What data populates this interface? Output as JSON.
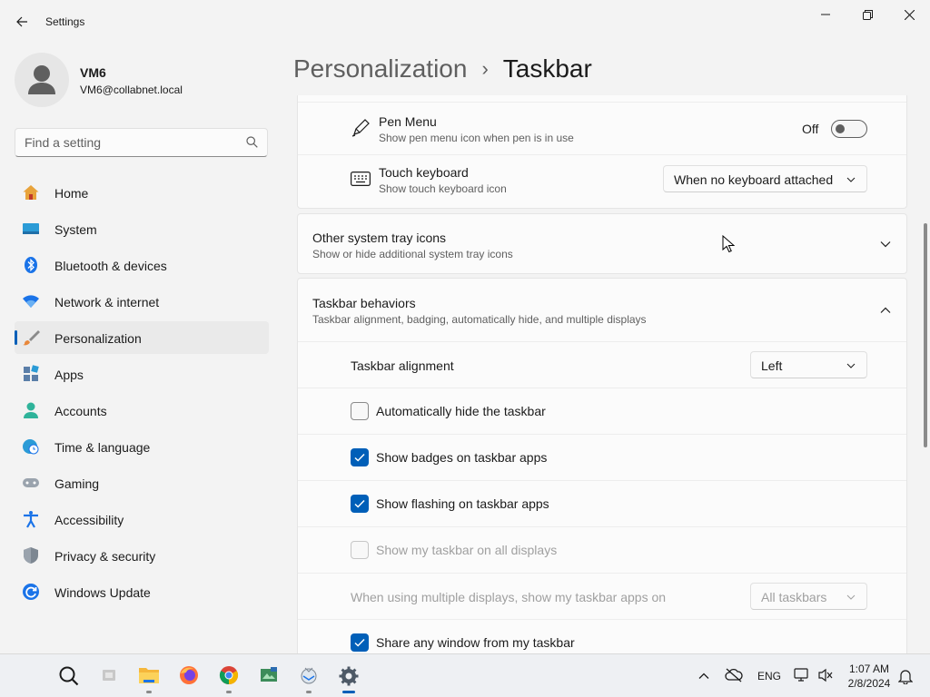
{
  "window": {
    "title": "Settings"
  },
  "profile": {
    "name": "VM6",
    "email": "VM6@collabnet.local"
  },
  "search": {
    "placeholder": "Find a setting"
  },
  "sidebar": {
    "items": [
      {
        "label": "Home",
        "icon": "home-icon"
      },
      {
        "label": "System",
        "icon": "system-icon"
      },
      {
        "label": "Bluetooth & devices",
        "icon": "bluetooth-icon"
      },
      {
        "label": "Network & internet",
        "icon": "wifi-icon"
      },
      {
        "label": "Personalization",
        "icon": "brush-icon",
        "active": true
      },
      {
        "label": "Apps",
        "icon": "apps-icon"
      },
      {
        "label": "Accounts",
        "icon": "person-icon"
      },
      {
        "label": "Time & language",
        "icon": "clock-globe-icon"
      },
      {
        "label": "Gaming",
        "icon": "gamepad-icon"
      },
      {
        "label": "Accessibility",
        "icon": "accessibility-icon"
      },
      {
        "label": "Privacy & security",
        "icon": "shield-icon"
      },
      {
        "label": "Windows Update",
        "icon": "update-icon"
      }
    ]
  },
  "breadcrumb": {
    "parent": "Personalization",
    "separator": "›",
    "current": "Taskbar"
  },
  "tray_card": {
    "pen_menu": {
      "title": "Pen Menu",
      "desc": "Show pen menu icon when pen is in use",
      "state_label": "Off",
      "on": false
    },
    "touch_keyboard": {
      "title": "Touch keyboard",
      "desc": "Show touch keyboard icon",
      "value": "When no keyboard attached"
    }
  },
  "other_tray": {
    "title": "Other system tray icons",
    "desc": "Show or hide additional system tray icons",
    "expanded": false
  },
  "behaviors": {
    "title": "Taskbar behaviors",
    "desc": "Taskbar alignment, badging, automatically hide, and multiple displays",
    "expanded": true,
    "alignment_label": "Taskbar alignment",
    "alignment_value": "Left",
    "auto_hide": {
      "label": "Automatically hide the taskbar",
      "checked": false
    },
    "badges": {
      "label": "Show badges on taskbar apps",
      "checked": true
    },
    "flashing": {
      "label": "Show flashing on taskbar apps",
      "checked": true
    },
    "all_displays": {
      "label": "Show my taskbar on all displays",
      "checked": false,
      "disabled": true
    },
    "multi_display_label": "When using multiple displays, show my taskbar apps on",
    "multi_display_value": "All taskbars",
    "share_window": {
      "label": "Share any window from my taskbar",
      "checked": true
    }
  },
  "taskbar": {
    "apps": [
      "search-icon",
      "task-view-icon",
      "file-explorer-icon",
      "firefox-icon",
      "chrome-icon",
      "app-icon",
      "mail-icon",
      "settings-icon"
    ],
    "tray": {
      "language": "ENG",
      "time": "1:07 AM",
      "date": "2/8/2024"
    }
  },
  "colors": {
    "accent": "#005fb8",
    "background": "#f3f3f3",
    "card": "#fbfbfb"
  }
}
